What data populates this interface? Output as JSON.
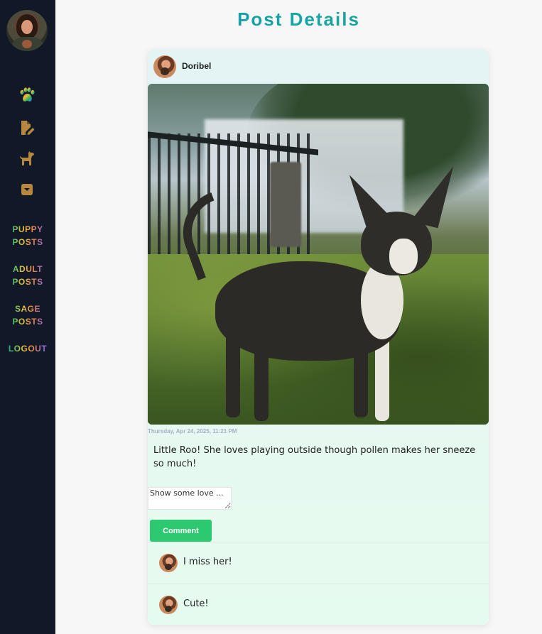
{
  "page": {
    "title": "Post Details"
  },
  "sidebar": {
    "icons": [
      {
        "name": "paw-icon",
        "color": "#7b6adf"
      },
      {
        "name": "file-pen-icon",
        "color": "#b8873f"
      },
      {
        "name": "dog-icon",
        "color": "#b8873f"
      },
      {
        "name": "archive-box-icon",
        "color": "#b8873f"
      }
    ],
    "links": {
      "puppy_line1": "PUPPY",
      "puppy_line2": "POSTS",
      "adult_line1": "ADULT",
      "adult_line2": "POSTS",
      "sage_line1": "SAGE",
      "sage_line2": "POSTS",
      "logout": "LOGOUT"
    }
  },
  "post": {
    "author": "Doribel",
    "timestamp": "Thursday, Apr 24, 2025, 11:21 PM",
    "caption": "Little Roo! She loves playing outside though pollen makes her sneeze so much!",
    "comment_placeholder": "Show some love ...",
    "comment_button": "Comment",
    "comments": [
      {
        "text": "I miss her!"
      },
      {
        "text": "Cute!"
      }
    ]
  },
  "colors": {
    "sidebar_bg": "#111827",
    "accent_green": "#2cc970",
    "title_gradient": [
      "#1591b9",
      "#21a57b"
    ]
  }
}
